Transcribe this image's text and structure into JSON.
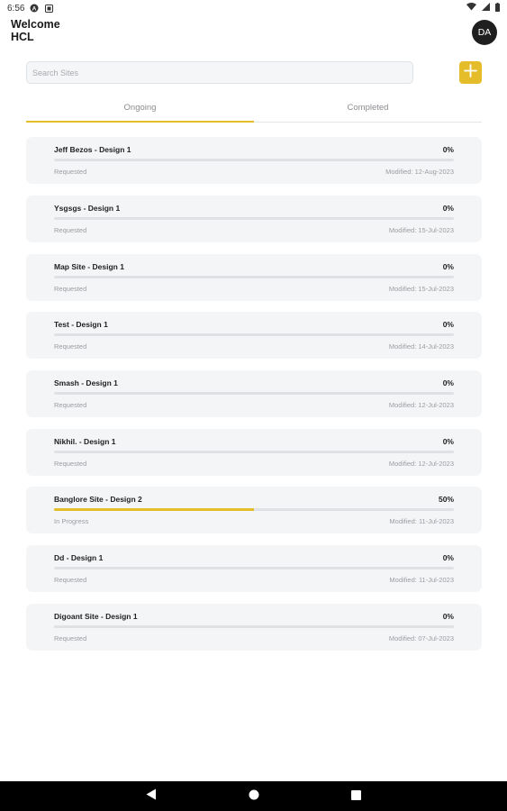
{
  "status_bar": {
    "time": "6:56"
  },
  "header": {
    "welcome_line1": "Welcome",
    "welcome_line2": "HCL",
    "avatar_initials": "DA"
  },
  "search": {
    "placeholder": "Search Sites",
    "value": ""
  },
  "tabs": [
    {
      "label": "Ongoing",
      "active": true
    },
    {
      "label": "Completed",
      "active": false
    }
  ],
  "sites": [
    {
      "name": "Jeff Bezos  - Design 1",
      "percent": "0%",
      "progress": 0,
      "status": "Requested",
      "modified": "Modified: 12-Aug-2023"
    },
    {
      "name": "Ysgsgs - Design 1",
      "percent": "0%",
      "progress": 0,
      "status": "Requested",
      "modified": "Modified: 15-Jul-2023"
    },
    {
      "name": "Map Site - Design 1",
      "percent": "0%",
      "progress": 0,
      "status": "Requested",
      "modified": "Modified: 15-Jul-2023"
    },
    {
      "name": "Test - Design 1",
      "percent": "0%",
      "progress": 0,
      "status": "Requested",
      "modified": "Modified: 14-Jul-2023"
    },
    {
      "name": "Smash - Design 1",
      "percent": "0%",
      "progress": 0,
      "status": "Requested",
      "modified": "Modified: 12-Jul-2023"
    },
    {
      "name": "Nikhil.  - Design 1",
      "percent": "0%",
      "progress": 0,
      "status": "Requested",
      "modified": "Modified: 12-Jul-2023"
    },
    {
      "name": "Banglore Site - Design 2",
      "percent": "50%",
      "progress": 50,
      "status": "In Progress",
      "modified": "Modified: 11-Jul-2023"
    },
    {
      "name": "Dd - Design 1",
      "percent": "0%",
      "progress": 0,
      "status": "Requested",
      "modified": "Modified: 11-Jul-2023"
    },
    {
      "name": "Digoant Site - Design 1",
      "percent": "0%",
      "progress": 0,
      "status": "Requested",
      "modified": "Modified: 07-Jul-2023"
    }
  ],
  "colors": {
    "accent": "#e5bd2b",
    "card_bg": "#f4f5f7",
    "nav_bg": "#000000"
  },
  "icons": {
    "add": "plus-icon",
    "back": "back-triangle-icon",
    "home": "home-circle-icon",
    "recents": "recents-square-icon"
  }
}
